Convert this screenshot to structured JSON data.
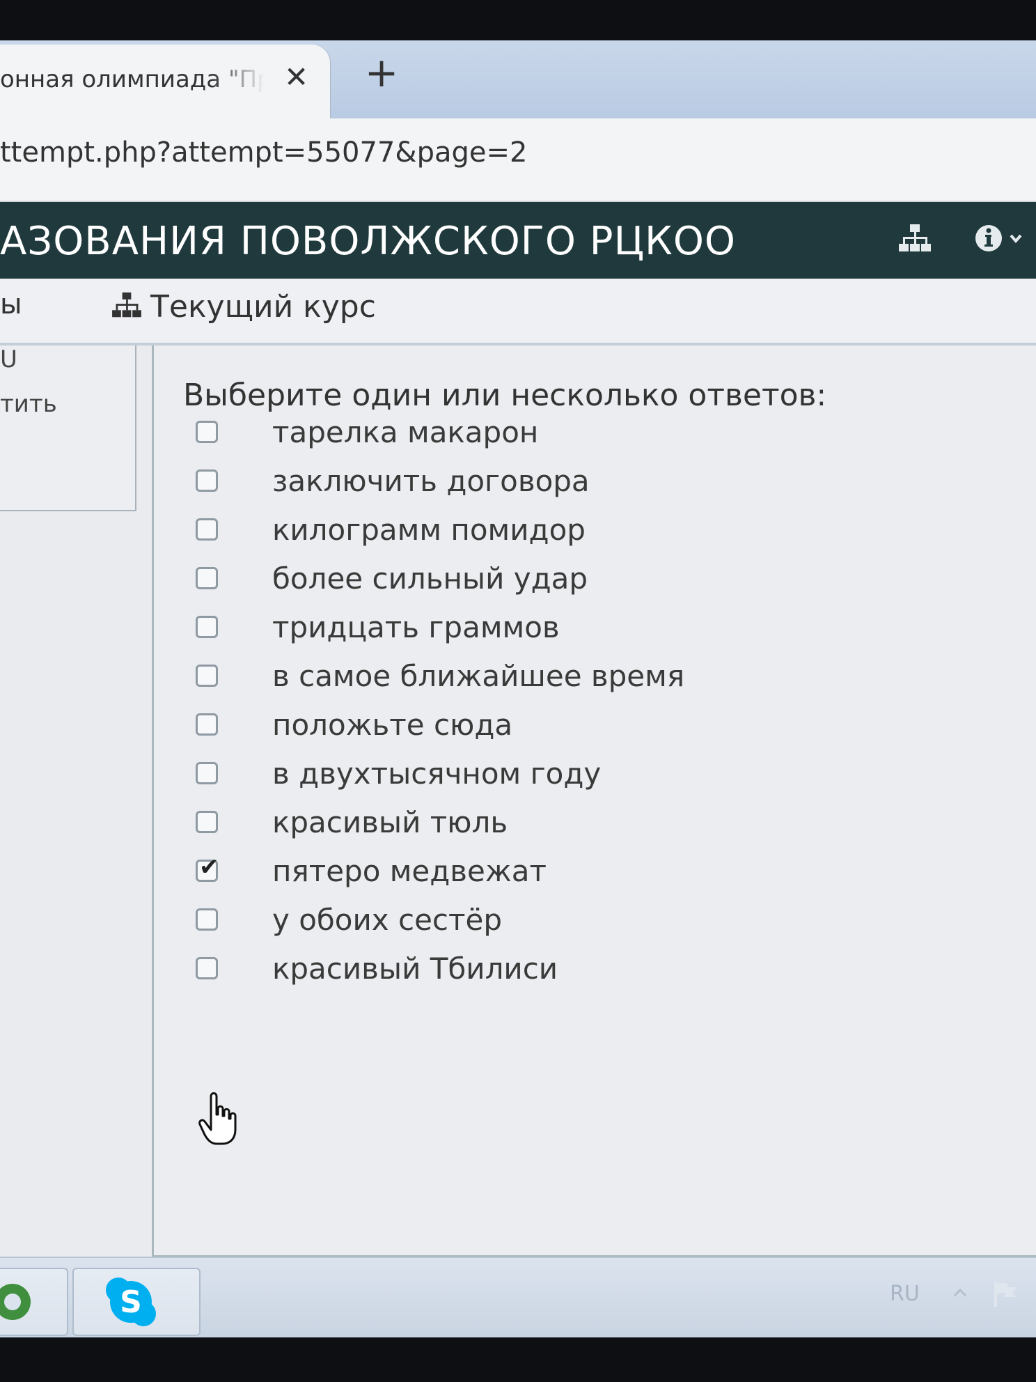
{
  "browser": {
    "tab": {
      "title": "онная олимпиада \"Пр",
      "close_glyph": "✕"
    },
    "new_tab_glyph": "+",
    "url": "ttempt.php?attempt=55077&page=2"
  },
  "site": {
    "title": "АЗОВАНИЯ ПОВОЛЖСКОГО РЦКОО"
  },
  "nav": {
    "left_fragment": "ы",
    "current_course": "Текущий курс"
  },
  "left_panel": {
    "fragment_1": "U",
    "fragment_2": "тить"
  },
  "question": {
    "prompt": "Выберите один или несколько ответов:",
    "options": [
      {
        "label": "тарелка макарон",
        "checked": false
      },
      {
        "label": "заключить договора",
        "checked": false
      },
      {
        "label": "килограмм помидор",
        "checked": false
      },
      {
        "label": "более сильный удар",
        "checked": false
      },
      {
        "label": "тридцать граммов",
        "checked": false
      },
      {
        "label": "в самое ближайшее время",
        "checked": false
      },
      {
        "label": "положьте сюда",
        "checked": false
      },
      {
        "label": "в двухтысячном году",
        "checked": false
      },
      {
        "label": "красивый тюль",
        "checked": false
      },
      {
        "label": "пятеро медвежат",
        "checked": true
      },
      {
        "label": "у обоих сестёр",
        "checked": false
      },
      {
        "label": "красивый Тбилиси",
        "checked": false
      }
    ]
  },
  "taskbar": {
    "language": "RU"
  },
  "colors": {
    "header_bg": "#20393c",
    "skype_blue": "#00aff0"
  }
}
